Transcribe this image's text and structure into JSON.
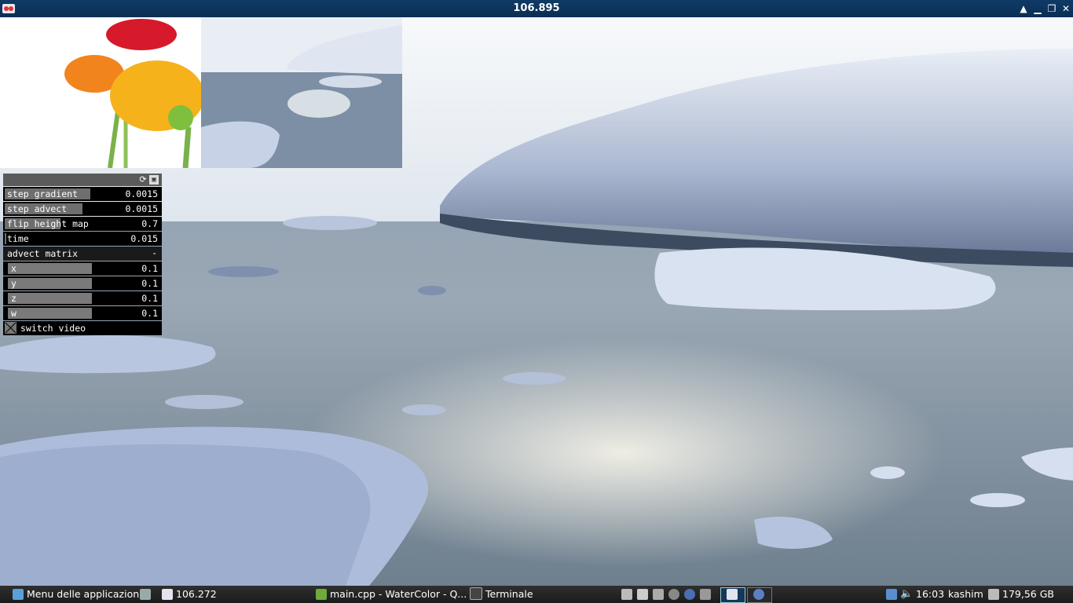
{
  "window": {
    "title": "106.895"
  },
  "gui": {
    "params": [
      {
        "label": "step gradient",
        "value": "0.0015",
        "fill": 0.55
      },
      {
        "label": "step advect",
        "value": "0.0015",
        "fill": 0.5
      },
      {
        "label": "flip height map",
        "value": "0.7",
        "fill": 0.36
      },
      {
        "label": "time",
        "value": "0.015",
        "fill": 0.01
      }
    ],
    "group": {
      "label": "advect matrix",
      "toggle": "-"
    },
    "matrix": [
      {
        "label": "x",
        "value": "0.1"
      },
      {
        "label": "y",
        "value": "0.1"
      },
      {
        "label": "z",
        "value": "0.1"
      },
      {
        "label": "w",
        "value": "0.1"
      }
    ],
    "switch": {
      "label": "switch video",
      "checked": false
    }
  },
  "taskbar": {
    "menu": "Menu delle applicazioni",
    "tasks": [
      {
        "label": "106.272"
      },
      {
        "label": "main.cpp - WaterColor - Q..."
      },
      {
        "label": "Terminale"
      }
    ],
    "clock": "16:03",
    "user": "kashim",
    "disk": "179,56 GB"
  },
  "colors": {
    "titlebar": "#0b2f55",
    "panel_header": "#5b5b5b",
    "taskbar": "#1b1b1b"
  }
}
